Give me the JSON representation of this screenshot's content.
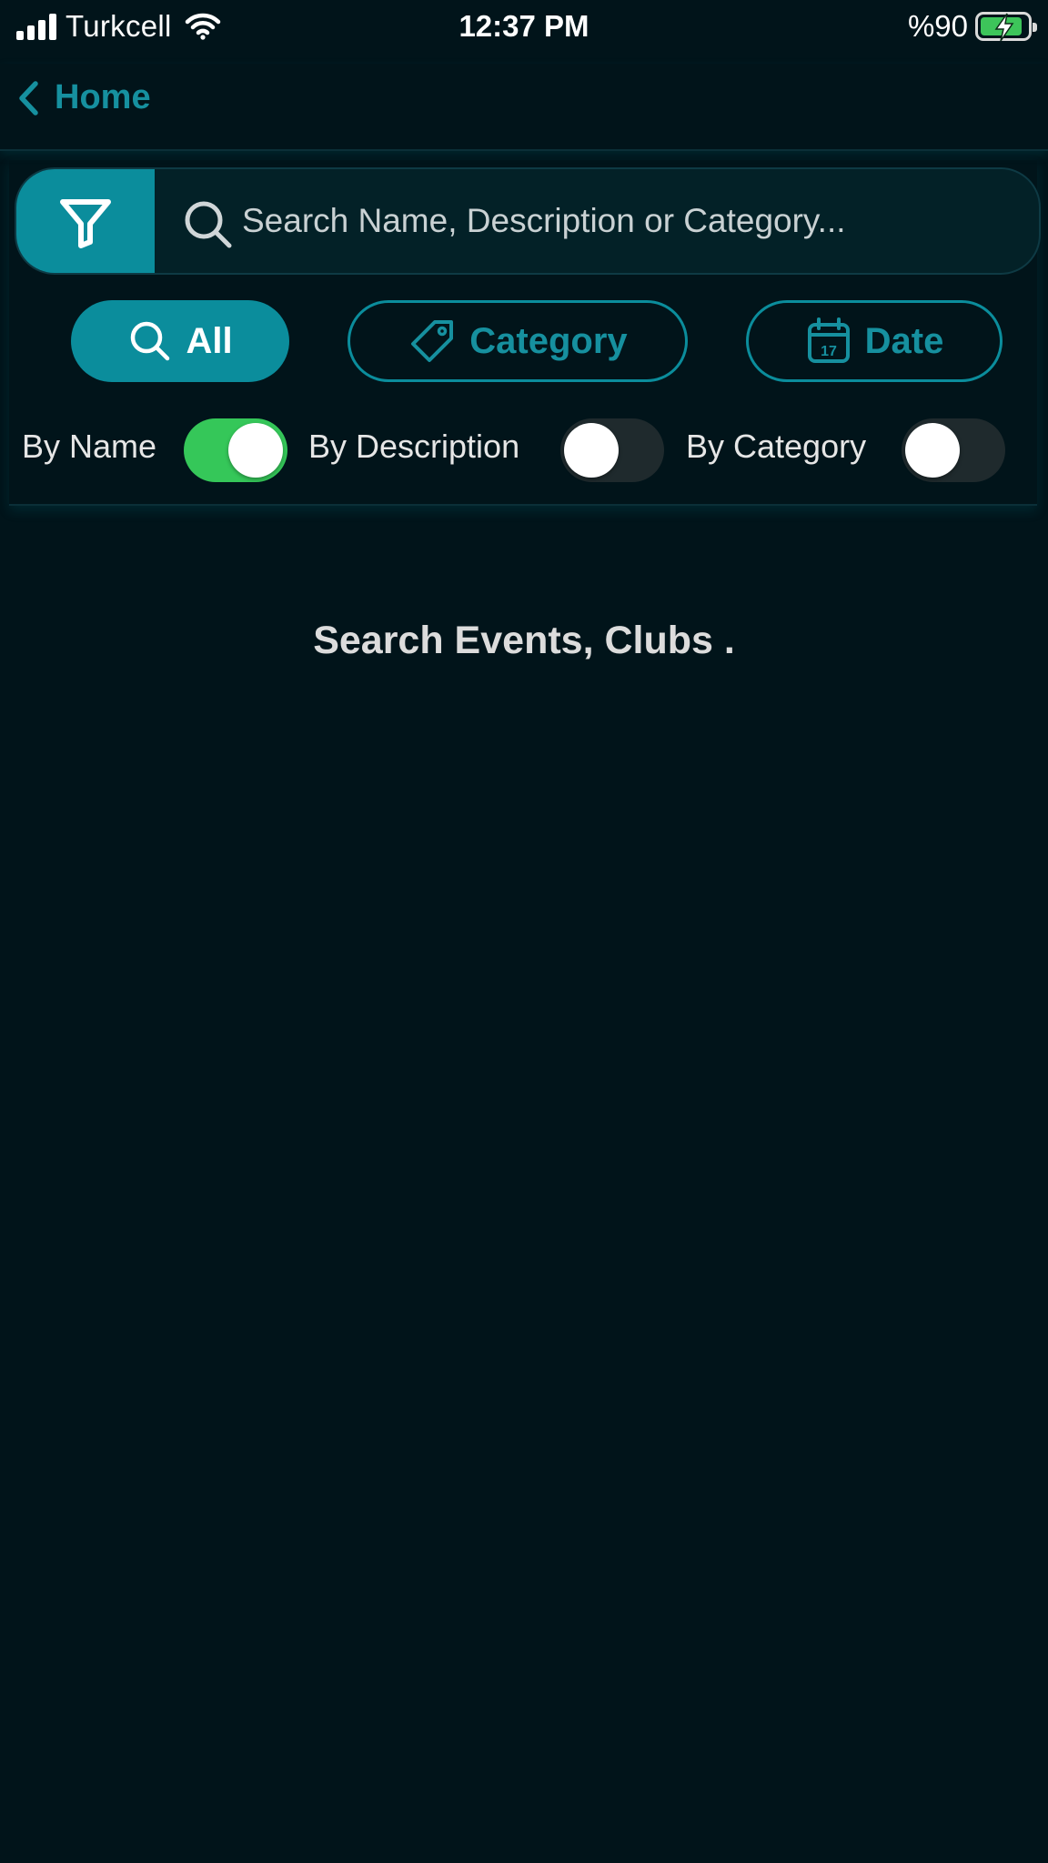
{
  "status_bar": {
    "carrier": "Turkcell",
    "time": "12:37 PM",
    "battery_text": "%90",
    "battery_level": 0.9
  },
  "nav": {
    "back_label": "Home"
  },
  "search": {
    "placeholder": "Search Name, Description or Category...",
    "value": ""
  },
  "chips": {
    "all": "All",
    "category": "Category",
    "date": "Date",
    "date_icon_day": "17"
  },
  "toggles": {
    "by_name": {
      "label": "By Name",
      "on": true
    },
    "by_description": {
      "label": "By Description",
      "on": false
    },
    "by_category": {
      "label": "By Category",
      "on": false
    }
  },
  "empty_message": "Search Events, Clubs .",
  "colors": {
    "background": "#01141a",
    "accent": "#0b8d9c",
    "switch_on": "#35c759"
  }
}
